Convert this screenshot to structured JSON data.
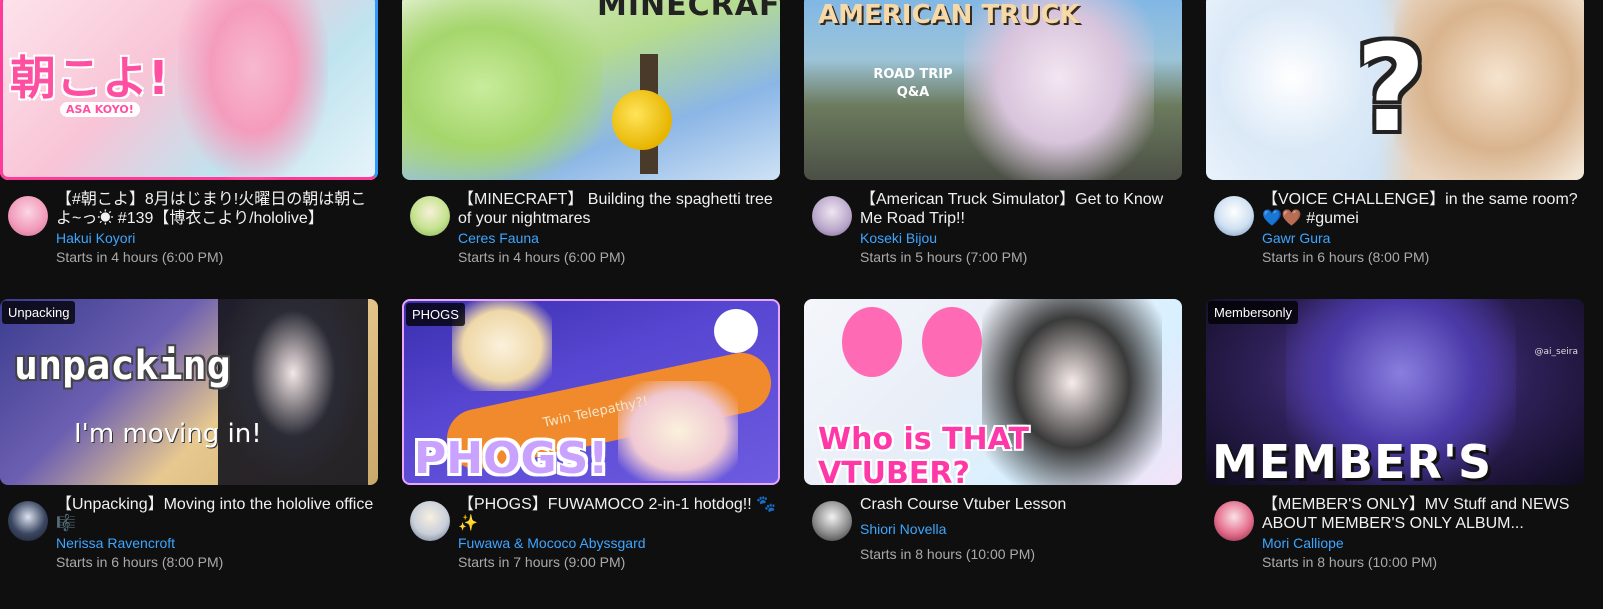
{
  "videos": [
    {
      "thumb_label": "",
      "thumb_text": "朝こよ!",
      "thumb_subtext": "ASA KOYO!",
      "title": "【#朝こよ】8月はじまり!火曜日の朝は朝こよ~っ☀ #139【博衣こより/hololive】",
      "channel": "Hakui Koyori",
      "status": "Starts in 4 hours (6:00 PM)"
    },
    {
      "thumb_label": "",
      "thumb_text": "MINECRAFT",
      "thumb_subtext": "",
      "title": "【MINECRAFT】 Building the spaghetti tree of your nightmares",
      "channel": "Ceres Fauna",
      "status": "Starts in 4 hours (6:00 PM)"
    },
    {
      "thumb_label": "",
      "thumb_text": "AMERICAN TRUCK",
      "thumb_subtext": "ROAD TRIP Q&A",
      "title": "【American Truck Simulator】Get to Know Me Road Trip!!",
      "channel": "Koseki Bijou",
      "status": "Starts in 5 hours (7:00 PM)"
    },
    {
      "thumb_label": "",
      "thumb_text": "?",
      "thumb_subtext": "",
      "title": "【VOICE CHALLENGE】in the same room? 💙🤎 #gumei",
      "channel": "Gawr Gura",
      "status": "Starts in 6 hours (8:00 PM)"
    },
    {
      "thumb_label": "Unpacking",
      "thumb_text": "unpacking",
      "thumb_subtext": "I'm moving in!",
      "title": "【Unpacking】Moving into the hololive office 🎼",
      "channel": "Nerissa Ravencroft",
      "status": "Starts in 6 hours (8:00 PM)"
    },
    {
      "thumb_label": "PHOGS",
      "thumb_text": "PHOGS!",
      "thumb_subtext": "Twin Telepathy?!",
      "title": "【PHOGS】FUWAMOCO 2-in-1 hotdog!! 🐾✨",
      "channel": "Fuwawa & Mococo Abyssgard",
      "status": "Starts in 7 hours (9:00 PM)"
    },
    {
      "thumb_label": "",
      "thumb_text": "Who is THAT VTUBER?",
      "thumb_subtext": "",
      "title": "Crash Course Vtuber Lesson",
      "channel": "Shiori Novella",
      "status": "Starts in 8 hours (10:00 PM)"
    },
    {
      "thumb_label": "Membersonly",
      "thumb_text": "MEMBER'S",
      "thumb_subtext": "@ai_seira",
      "title": "【MEMBER'S ONLY】MV Stuff and NEWS ABOUT MEMBER'S ONLY ALBUM...",
      "channel": "Mori Calliope",
      "status": "Starts in 8 hours (10:00 PM)"
    }
  ],
  "colors": {
    "background": "#0f0f0f",
    "channel_link": "#3ea6ff",
    "secondary_text": "#aaaaaa"
  }
}
